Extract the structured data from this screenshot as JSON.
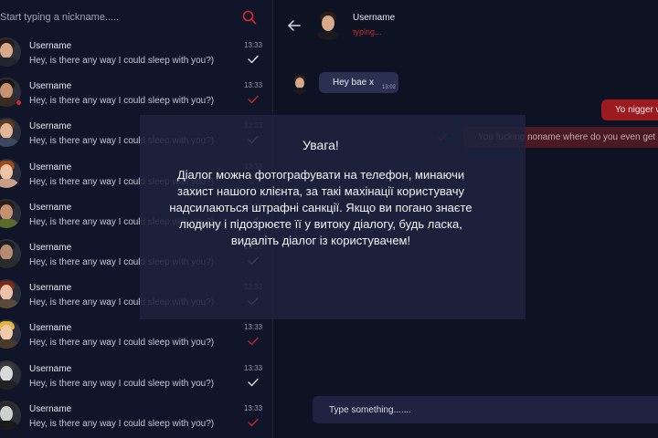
{
  "search": {
    "placeholder": "Start typing a nickname.....",
    "icon": "search-icon",
    "icon_color": "#e0252c"
  },
  "contacts": [
    {
      "name": "Username",
      "message": "Hey, is there any way I could sleep with you?)",
      "time": "13:33",
      "read_state": "check-white",
      "online": false
    },
    {
      "name": "Username",
      "message": "Hey, is there any way I could sleep with you?)",
      "time": "13:33",
      "read_state": "check-red",
      "online": true
    },
    {
      "name": "Username",
      "message": "Hey, is there any way I could sleep with you?)",
      "time": "13:33",
      "read_state": "check-white",
      "online": false
    },
    {
      "name": "Username",
      "message": "Hey, is there any way I could sleep with you?)",
      "time": "13:33",
      "read_state": "check-red",
      "online": false
    },
    {
      "name": "Username",
      "message": "Hey, is there any way I could sleep with you?)",
      "time": "13:33",
      "read_state": "check-white",
      "online": false
    },
    {
      "name": "Username",
      "message": "Hey, is there any way I could sleep with you?)",
      "time": "13:33",
      "read_state": "check-white",
      "online": false
    },
    {
      "name": "Username",
      "message": "Hey, is there any way I could sleep with you?)",
      "time": "13:33",
      "read_state": "check-white",
      "online": false
    },
    {
      "name": "Username",
      "message": "Hey, is there any way I could sleep with you?)",
      "time": "13:33",
      "read_state": "check-red",
      "online": false
    },
    {
      "name": "Username",
      "message": "Hey, is there any way I could sleep with you?)",
      "time": "13:33",
      "read_state": "check-white",
      "online": false
    },
    {
      "name": "Username",
      "message": "Hey, is there any way I could sleep with you?)",
      "time": "13:33",
      "read_state": "check-red",
      "online": false
    }
  ],
  "chat_header": {
    "back_icon": "arrow-left-icon",
    "name": "Username",
    "status": "typing...",
    "status_color": "#c0272d"
  },
  "messages": {
    "incoming": {
      "text": "Hey bae x",
      "time": "13:02"
    },
    "outgoing_1": {
      "text": "Yo nigger w"
    },
    "outgoing_2": {
      "text": "You fucking noname where do you even get lo"
    }
  },
  "composer": {
    "placeholder": "Type something......."
  },
  "modal": {
    "title": "Увага!",
    "body": "Діалог можна фотографувати на телефон, минаючи захист нашого клієнта, за такі махінації користувачу надсилаються штрафні санкції. Якщо ви погано знаєте людину і підозрюєте її у витоку діалогу, будь ласка, видаліть діалог із користувачем!"
  },
  "colors": {
    "background": "#0e1324",
    "panel": "#10152a",
    "accent_red": "#e0252c",
    "bubble_in": "#2a3150",
    "bubble_out": "#9b1b1f"
  }
}
